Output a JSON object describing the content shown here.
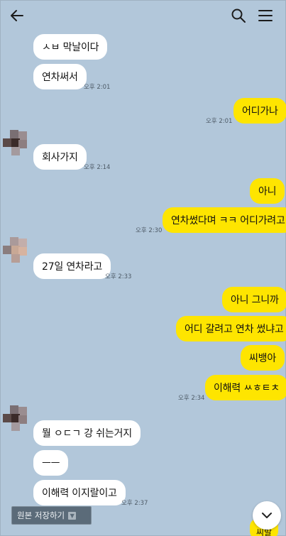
{
  "header": {
    "title": "",
    "back_icon": "arrow-left-icon",
    "search_icon": "search-icon",
    "menu_icon": "hamburger-menu-icon"
  },
  "messages": [
    {
      "side": "in",
      "text": "ㅅㅂ 막날이다"
    },
    {
      "side": "in",
      "text": "연차써서",
      "time": "오후 2:01"
    },
    {
      "side": "out",
      "text": "어디가나",
      "time": "오후 2:01"
    },
    {
      "side": "in",
      "text": "회사가지",
      "time": "오후 2:14"
    },
    {
      "side": "out",
      "text": "아니"
    },
    {
      "side": "out",
      "text": "연차썼다며 ㅋㅋ 어디가려고",
      "time": "오후 2:30"
    },
    {
      "side": "in",
      "text": "27일 연차라고",
      "time": "오후 2:33"
    },
    {
      "side": "out",
      "text": "아니 그니까"
    },
    {
      "side": "out",
      "text": "어디 갈려고 연차 썼냐고"
    },
    {
      "side": "out",
      "text": "씨뱅아"
    },
    {
      "side": "out",
      "text": "이해력 ㅆㅎㅌㅊ",
      "time": "오후 2:34"
    },
    {
      "side": "in",
      "text": "뭘 ㅇㄷㄱ 강 쉬는거지"
    },
    {
      "side": "in",
      "text": "ㅡㅡ"
    },
    {
      "side": "in",
      "text": "이해력  이지랄이고",
      "time": "오후 2:37"
    },
    {
      "side": "out",
      "text": "씨발"
    }
  ],
  "bottom": {
    "save_original_label": "원본 저장하기",
    "dropdown_icon": "chevron-down-icon",
    "scroll_down_icon": "chevron-down-icon"
  },
  "colors": {
    "background": "#b2c7da",
    "incoming_bubble": "#ffffff",
    "outgoing_bubble": "#fee500",
    "timestamp": "#4d5a66"
  }
}
